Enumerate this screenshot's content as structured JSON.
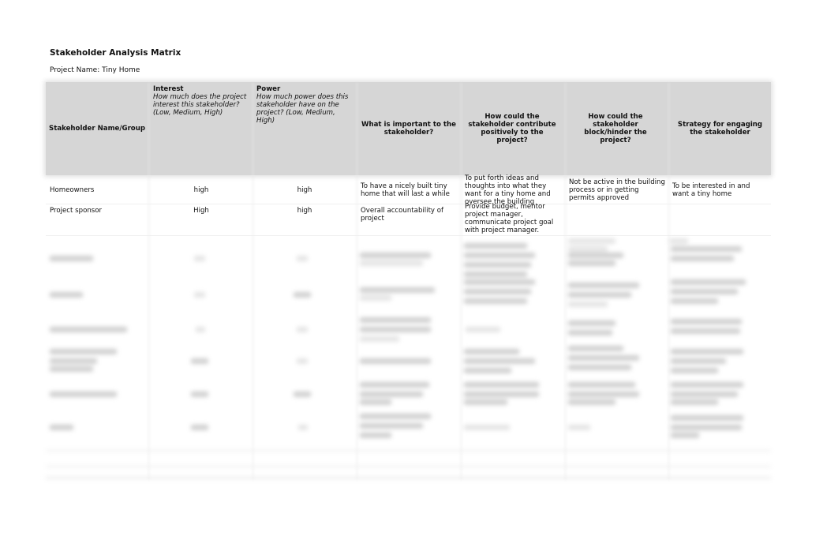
{
  "document": {
    "title": "Stakeholder Analysis Matrix",
    "project_name": "Project Name: Tiny Home"
  },
  "table": {
    "headers": [
      {
        "label": "Stakeholder Name/Group",
        "sub": ""
      },
      {
        "label": "Interest",
        "sub": "How much does the project interest this stakeholder? (Low, Medium, High)"
      },
      {
        "label": "Power",
        "sub": "How much power does this stakeholder have on the project? (Low, Medium, High)"
      },
      {
        "label": "What is important to the stakeholder?",
        "sub": ""
      },
      {
        "label": "How could the stakeholder contribute positively to the project?",
        "sub": ""
      },
      {
        "label": "How could the stakeholder block/hinder the project?",
        "sub": ""
      },
      {
        "label": "Strategy for engaging the stakeholder",
        "sub": ""
      }
    ],
    "rows": [
      {
        "stakeholder": "Homeowners",
        "interest": "high",
        "power": "high",
        "important": "To have a nicely built tiny home that will last a while",
        "contribute": "To put forth ideas and thoughts into what they want for a tiny home and oversee the building",
        "hinder": "Not be active in the building process or in getting permits approved",
        "strategy": "To be interested in and want a tiny home"
      },
      {
        "stakeholder": "Project sponsor",
        "interest": "High",
        "power": "high",
        "important": "Overall accountability of project",
        "contribute": "Provide budget, mentor project manager, communicate project goal with project manager.",
        "hinder": "",
        "strategy": ""
      }
    ],
    "blurred_rows_note": "remaining rows obscured"
  }
}
